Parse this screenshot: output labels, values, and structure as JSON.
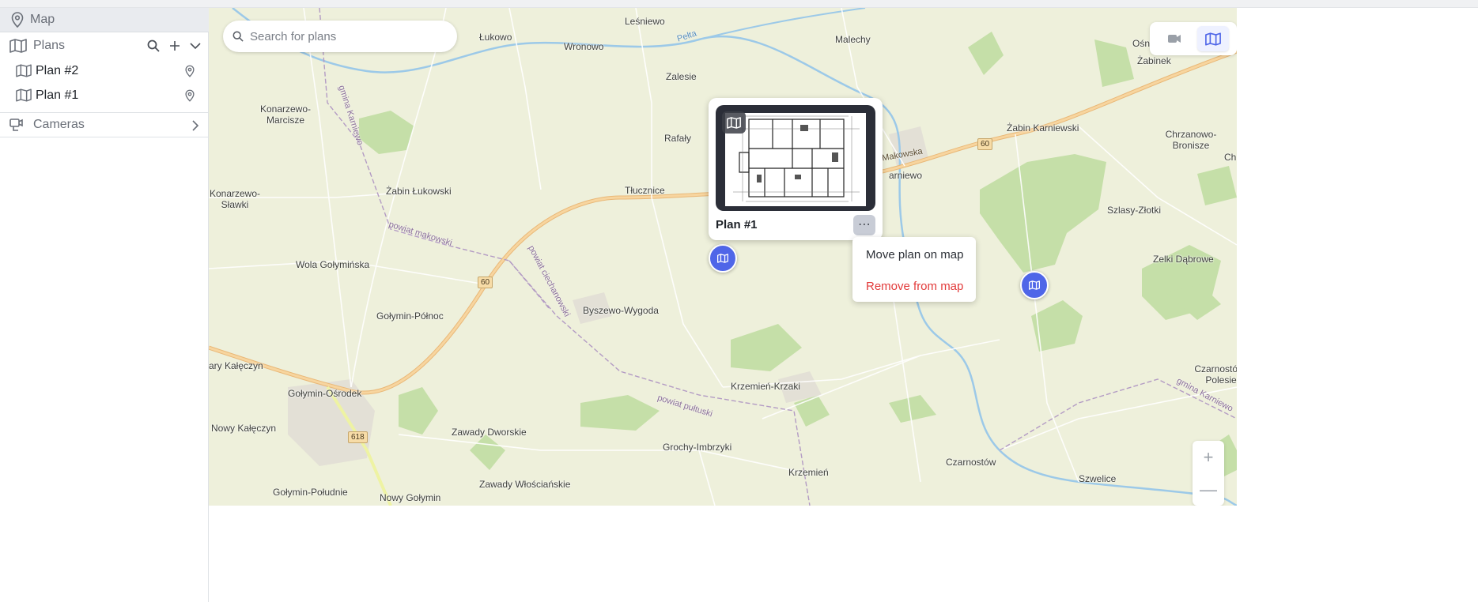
{
  "sidebar": {
    "map_label": "Map",
    "plans_label": "Plans",
    "plans": [
      {
        "label": "Plan #2"
      },
      {
        "label": "Plan #1"
      }
    ],
    "cameras_label": "Cameras"
  },
  "search": {
    "placeholder": "Search for plans"
  },
  "map": {
    "places": [
      "Leśniewo",
      "Łukowo",
      "Wronowo",
      "Malechy",
      "Ośnica",
      "Żabinek",
      "Zalesie",
      "Konarzewo-\nMarcisze",
      "Rafały",
      "Żabin Karniewski",
      "Chrzanowo-\nBronisze",
      "Ch",
      "Żabin Łukowski",
      "Tłucznice",
      "arniewo",
      "Konarzewo-\nSławki",
      "Szlasy-Złotki",
      "Wola Gołymińska",
      "Zelki Dąbrowe",
      "Byszewo-Wygoda",
      "Gołymin-Północ",
      "ary Kałęczyn",
      "Czarnostów-\nPolesie",
      "Krzemień-Krzaki",
      "Gołymin-Ośrodek",
      "Nowy Kałęczyn",
      "Zawady Dworskie",
      "Grochy-Imbrzyki",
      "Czarnostów",
      "Krzemień",
      "Szwelice",
      "Zawady Włościańskie",
      "Gołymin-Południe",
      "Nowy Gołymin"
    ],
    "road_shields": [
      "60",
      "60",
      "618"
    ],
    "boundary_labels": [
      "powiat makowski",
      "powiat ciechanowski",
      "powiat pułtuski",
      "gmina Karniewo",
      "gmina Karniewo",
      "Pełta",
      "Makowska"
    ],
    "zoom_in": "+",
    "zoom_out": "—"
  },
  "popup": {
    "title": "Plan #1",
    "more_label": "⋯"
  },
  "menu": {
    "move_label": "Move plan on map",
    "remove_label": "Remove from map"
  },
  "colors": {
    "accent": "#4f66e8",
    "danger": "#e23b3b",
    "map_bg": "#eef0db",
    "forest": "#c5dfa8"
  }
}
